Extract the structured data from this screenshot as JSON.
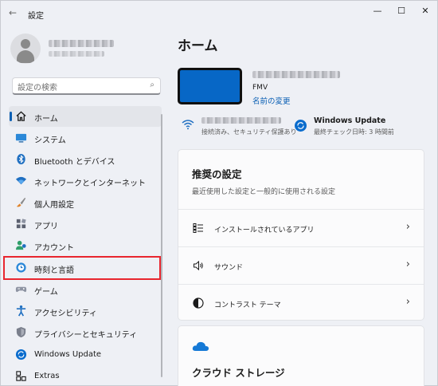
{
  "window": {
    "title": "設定",
    "controls": {
      "minimize": "—",
      "maximize": "☐",
      "close": "✕"
    }
  },
  "search": {
    "placeholder": "設定の検索",
    "value": ""
  },
  "sidebar": {
    "items": [
      {
        "label": "ホーム",
        "icon": "home-icon",
        "active": true
      },
      {
        "label": "システム",
        "icon": "system-monitor-icon"
      },
      {
        "label": "Bluetooth とデバイス",
        "icon": "bluetooth-icon"
      },
      {
        "label": "ネットワークとインターネット",
        "icon": "wifi-network-icon"
      },
      {
        "label": "個人用設定",
        "icon": "paintbrush-icon"
      },
      {
        "label": "アプリ",
        "icon": "apps-icon"
      },
      {
        "label": "アカウント",
        "icon": "account-icon"
      },
      {
        "label": "時刻と言語",
        "icon": "time-language-icon",
        "highlighted": true
      },
      {
        "label": "ゲーム",
        "icon": "gamepad-icon"
      },
      {
        "label": "アクセシビリティ",
        "icon": "accessibility-icon"
      },
      {
        "label": "プライバシーとセキュリティ",
        "icon": "shield-icon"
      },
      {
        "label": "Windows Update",
        "icon": "windows-update-icon"
      },
      {
        "label": "Extras",
        "icon": "extras-icon"
      }
    ]
  },
  "main": {
    "title": "ホーム",
    "device": {
      "model": "FMV",
      "rename_link": "名前の変更"
    },
    "network": {
      "status": "接続済み、セキュリティ保護あり"
    },
    "windows_update": {
      "title": "Windows Update",
      "last_check": "最終チェック日時: 3 時間前"
    },
    "recommended": {
      "title": "推奨の設定",
      "subtitle": "最近使用した設定と一般的に使用される設定",
      "rows": [
        {
          "label": "インストールされているアプリ",
          "icon": "installed-apps-icon"
        },
        {
          "label": "サウンド",
          "icon": "speaker-icon"
        },
        {
          "label": "コントラスト テーマ",
          "icon": "contrast-icon"
        }
      ]
    },
    "cloud": {
      "title": "クラウド ストレージ",
      "icon": "onedrive-cloud-icon"
    }
  },
  "colors": {
    "accent": "#0a5fb4",
    "highlight_border": "#e8262f",
    "device_screen": "#0767c6"
  }
}
